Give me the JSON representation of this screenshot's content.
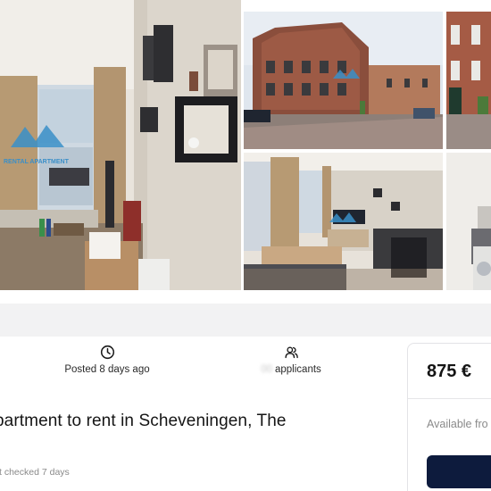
{
  "gallery": {
    "watermark_text": "RENTAL APARTMENT",
    "photos": [
      {
        "name": "main-interior"
      },
      {
        "name": "street-corner"
      },
      {
        "name": "street-side"
      },
      {
        "name": "living-room"
      },
      {
        "name": "laundry"
      }
    ]
  },
  "stats": {
    "posted": {
      "icon": "clock-icon",
      "label": "Posted 8 days ago"
    },
    "applicants": {
      "icon": "users-icon",
      "count_hidden": "00",
      "label": "applicants"
    }
  },
  "listing": {
    "title": "partment to rent in Scheveningen, The",
    "last_checked": "t checked 7 days"
  },
  "price_card": {
    "price": "875 €",
    "available_label": "Available fro",
    "button_label": ""
  },
  "colors": {
    "accent_navy": "#0d1b3d",
    "watermark_blue": "#3a8fc8",
    "band_gray": "#f2f2f3"
  }
}
